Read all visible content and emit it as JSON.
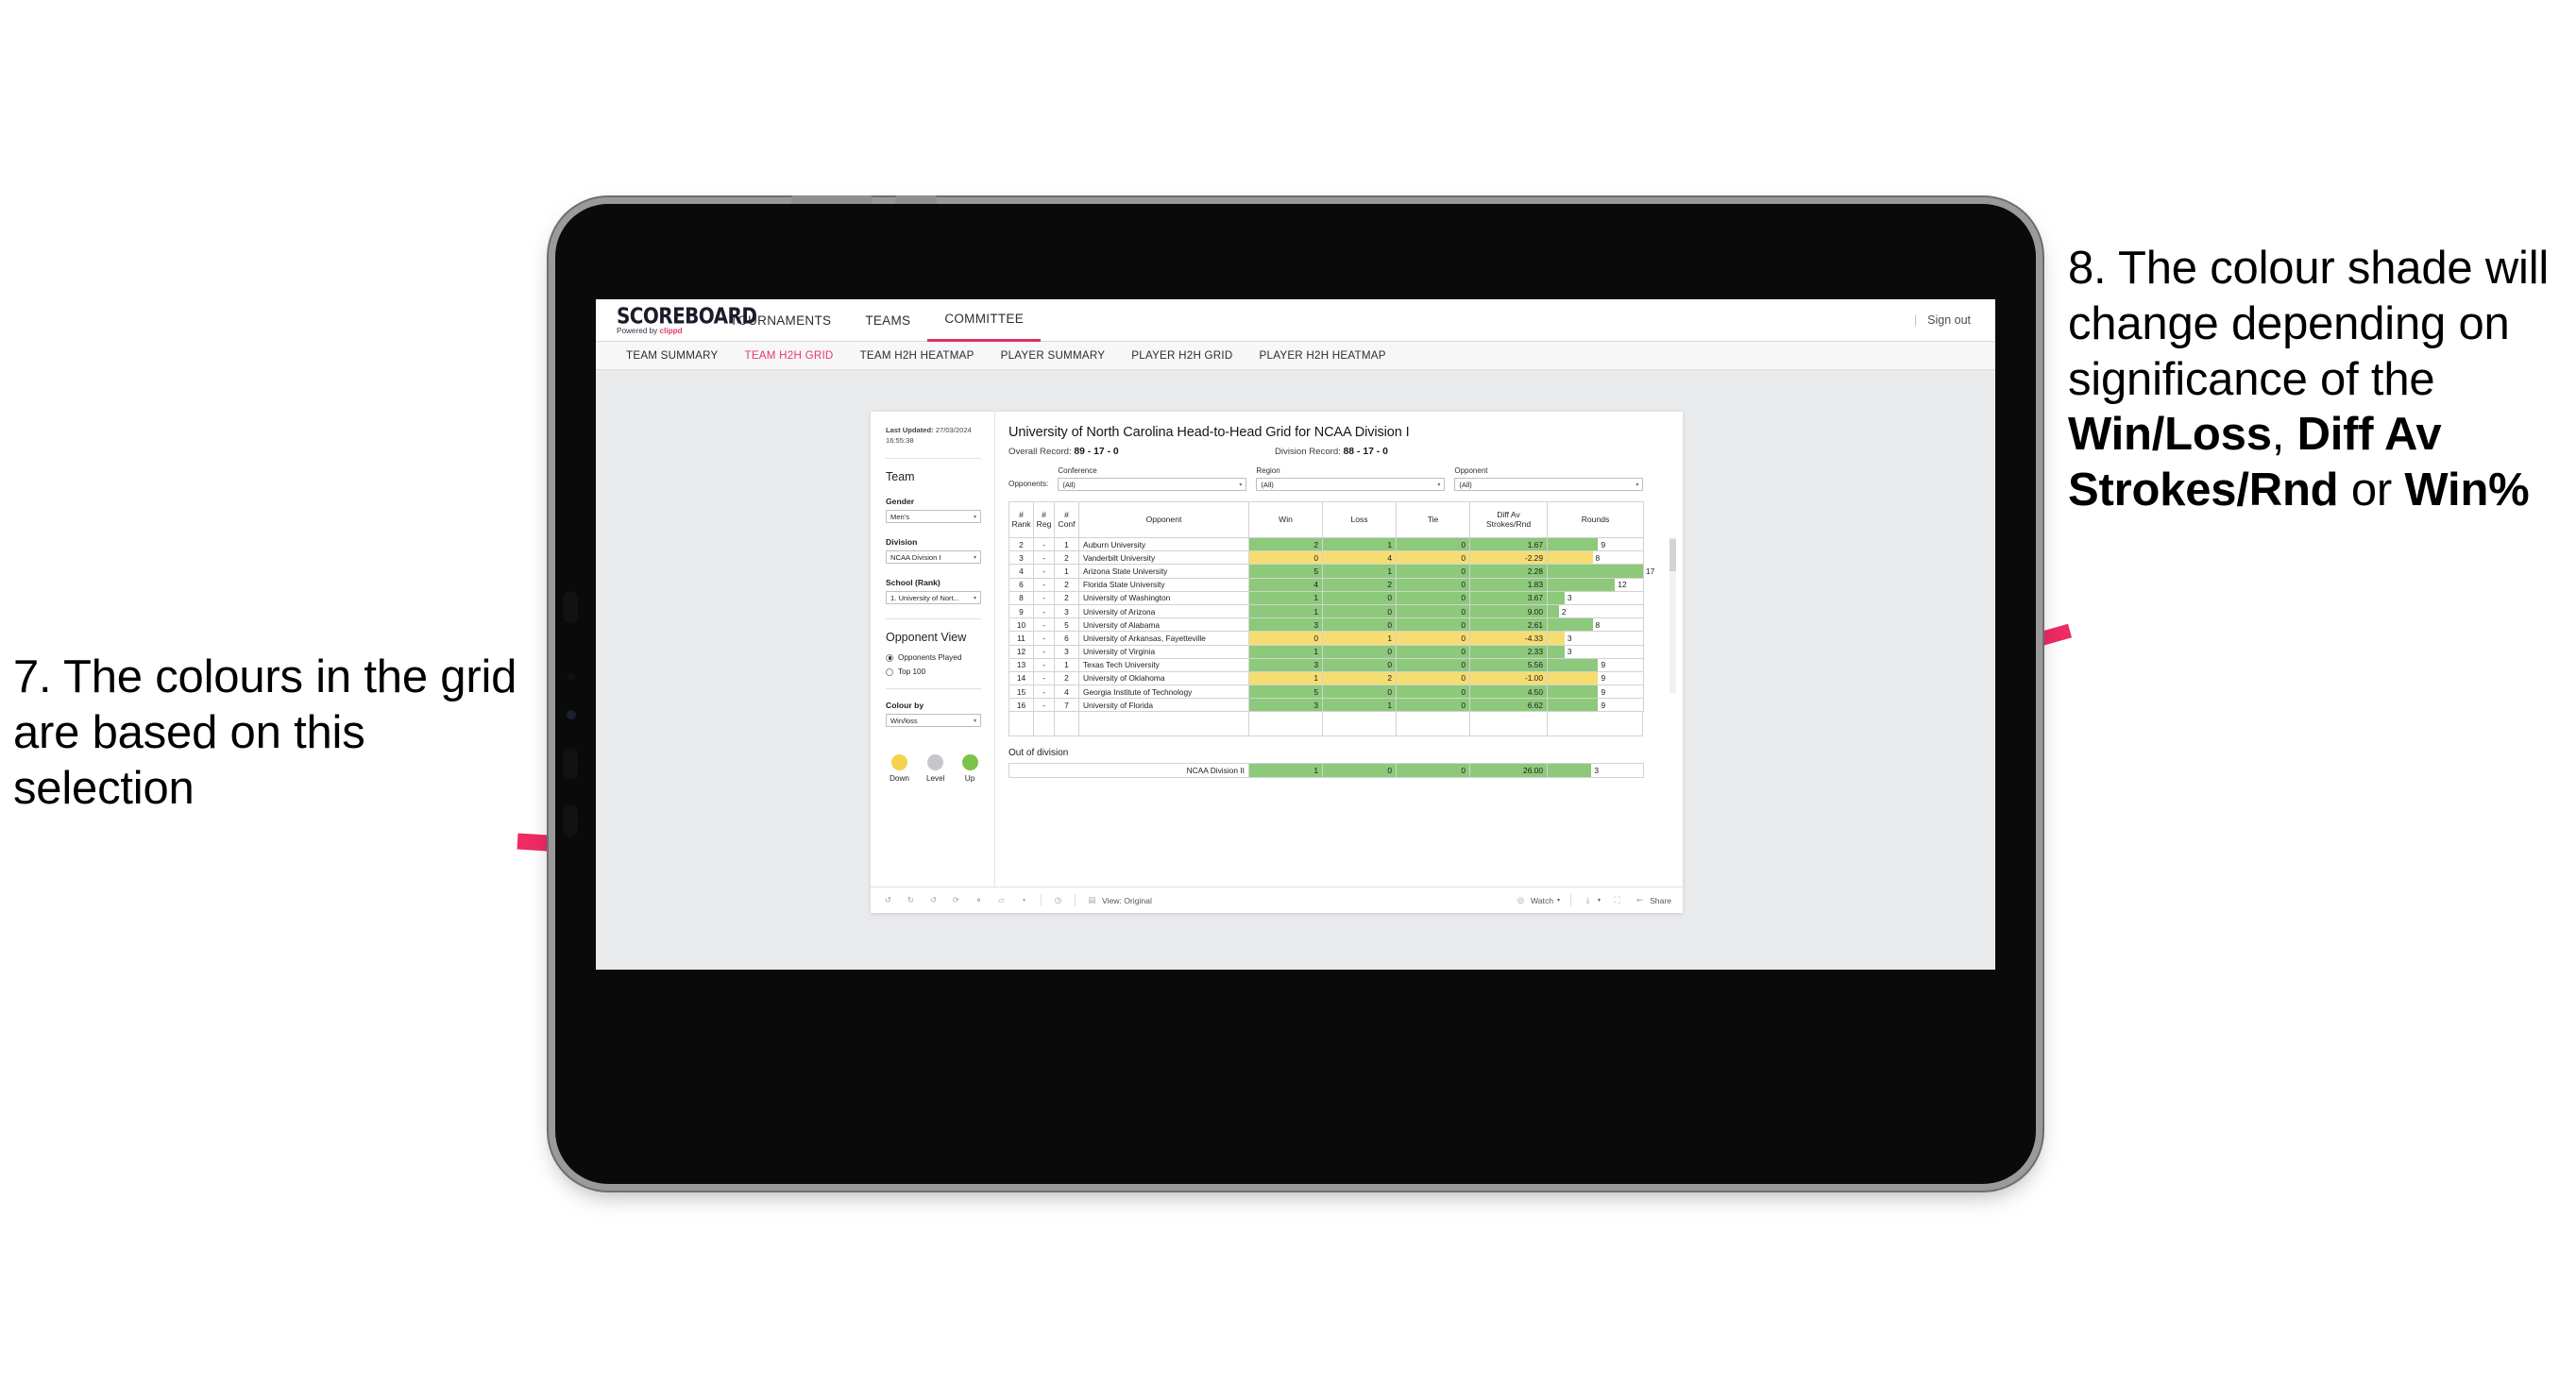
{
  "annotations": {
    "left": "7. The colours in the grid are based on this selection",
    "right_parts": [
      {
        "t": "8. The colour shade will change depending on significance of the ",
        "b": false
      },
      {
        "t": "Win/Loss",
        "b": true
      },
      {
        "t": ", ",
        "b": false
      },
      {
        "t": "Diff Av Strokes/Rnd",
        "b": true
      },
      {
        "t": " or ",
        "b": false
      },
      {
        "t": "Win%",
        "b": true
      }
    ],
    "arrow_color": "#ee2b62"
  },
  "app": {
    "brand_title": "SCOREBOARD",
    "brand_sub_pre": "Powered by ",
    "brand_sub_name": "clippd",
    "brand_accent": "#e8366b",
    "topnav": [
      {
        "label": "TOURNAMENTS",
        "active": false
      },
      {
        "label": "TEAMS",
        "active": false
      },
      {
        "label": "COMMITTEE",
        "active": true
      }
    ],
    "signout": {
      "divider": "|",
      "label": "Sign out"
    },
    "subnav": [
      {
        "label": "TEAM SUMMARY",
        "active": false
      },
      {
        "label": "TEAM H2H GRID",
        "active": true
      },
      {
        "label": "TEAM H2H HEATMAP",
        "active": false
      },
      {
        "label": "PLAYER SUMMARY",
        "active": false
      },
      {
        "label": "PLAYER H2H GRID",
        "active": false
      },
      {
        "label": "PLAYER H2H HEATMAP",
        "active": false
      }
    ]
  },
  "sidebar": {
    "last_updated_label": "Last Updated:",
    "last_updated_value": "27/03/2024 16:55:38",
    "team_heading": "Team",
    "fields": [
      {
        "label": "Gender",
        "value": "Men's"
      },
      {
        "label": "Division",
        "value": "NCAA Division I"
      },
      {
        "label": "School (Rank)",
        "value": "1. University of Nort..."
      }
    ],
    "opponent_view_heading": "Opponent View",
    "opponent_view_options": [
      {
        "label": "Opponents Played",
        "selected": true
      },
      {
        "label": "Top 100",
        "selected": false
      }
    ],
    "colour_by_label": "Colour by",
    "colour_by_value": "Win/loss",
    "legend": [
      {
        "label": "Down",
        "color": "#f4d24e"
      },
      {
        "label": "Level",
        "color": "#c6c6cb"
      },
      {
        "label": "Up",
        "color": "#7dc24b"
      }
    ]
  },
  "viz": {
    "title": "University of North Carolina Head-to-Head Grid for NCAA Division I",
    "overall_record_label": "Overall Record:",
    "overall_record_value": "89 - 17 - 0",
    "division_record_label": "Division Record:",
    "division_record_value": "88 - 17 - 0",
    "opponents_label": "Opponents:",
    "filters": [
      {
        "title": "Conference",
        "value": "(All)"
      },
      {
        "title": "Region",
        "value": "(All)"
      },
      {
        "title": "Opponent",
        "value": "(All)"
      }
    ],
    "out_of_division_label": "Out of division"
  },
  "chart_data": {
    "type": "table",
    "title": "University of North Carolina Head-to-Head Grid for NCAA Division I",
    "columns": [
      "# Rank",
      "# Reg",
      "# Conf",
      "Opponent",
      "Win",
      "Loss",
      "Tie",
      "Diff Av Strokes/Rnd",
      "Rounds"
    ],
    "colour_by": "Win/loss",
    "colours": {
      "up": "#8dc97a",
      "down": "#f5dd72",
      "level": "#c6c6cb",
      "bar": "#8dc97a",
      "bar_down": "#f5dd72"
    },
    "rounds_max": 17,
    "rows": [
      {
        "rank": "2",
        "reg": "-",
        "conf": "1",
        "opponent": "Auburn University",
        "win": "2",
        "loss": "1",
        "tie": "0",
        "diff": "1.67",
        "rounds": "9",
        "state": "up"
      },
      {
        "rank": "3",
        "reg": "-",
        "conf": "2",
        "opponent": "Vanderbilt University",
        "win": "0",
        "loss": "4",
        "tie": "0",
        "diff": "-2.29",
        "rounds": "8",
        "state": "down"
      },
      {
        "rank": "4",
        "reg": "-",
        "conf": "1",
        "opponent": "Arizona State University",
        "win": "5",
        "loss": "1",
        "tie": "0",
        "diff": "2.28",
        "rounds": "17",
        "state": "up"
      },
      {
        "rank": "6",
        "reg": "-",
        "conf": "2",
        "opponent": "Florida State University",
        "win": "4",
        "loss": "2",
        "tie": "0",
        "diff": "1.83",
        "rounds": "12",
        "state": "up"
      },
      {
        "rank": "8",
        "reg": "-",
        "conf": "2",
        "opponent": "University of Washington",
        "win": "1",
        "loss": "0",
        "tie": "0",
        "diff": "3.67",
        "rounds": "3",
        "state": "up"
      },
      {
        "rank": "9",
        "reg": "-",
        "conf": "3",
        "opponent": "University of Arizona",
        "win": "1",
        "loss": "0",
        "tie": "0",
        "diff": "9.00",
        "rounds": "2",
        "state": "up"
      },
      {
        "rank": "10",
        "reg": "-",
        "conf": "5",
        "opponent": "University of Alabama",
        "win": "3",
        "loss": "0",
        "tie": "0",
        "diff": "2.61",
        "rounds": "8",
        "state": "up"
      },
      {
        "rank": "11",
        "reg": "-",
        "conf": "6",
        "opponent": "University of Arkansas, Fayetteville",
        "win": "0",
        "loss": "1",
        "tie": "0",
        "diff": "-4.33",
        "rounds": "3",
        "state": "down"
      },
      {
        "rank": "12",
        "reg": "-",
        "conf": "3",
        "opponent": "University of Virginia",
        "win": "1",
        "loss": "0",
        "tie": "0",
        "diff": "2.33",
        "rounds": "3",
        "state": "up"
      },
      {
        "rank": "13",
        "reg": "-",
        "conf": "1",
        "opponent": "Texas Tech University",
        "win": "3",
        "loss": "0",
        "tie": "0",
        "diff": "5.56",
        "rounds": "9",
        "state": "up"
      },
      {
        "rank": "14",
        "reg": "-",
        "conf": "2",
        "opponent": "University of Oklahoma",
        "win": "1",
        "loss": "2",
        "tie": "0",
        "diff": "-1.00",
        "rounds": "9",
        "state": "down"
      },
      {
        "rank": "15",
        "reg": "-",
        "conf": "4",
        "opponent": "Georgia Institute of Technology",
        "win": "5",
        "loss": "0",
        "tie": "0",
        "diff": "4.50",
        "rounds": "9",
        "state": "up"
      },
      {
        "rank": "16",
        "reg": "-",
        "conf": "7",
        "opponent": "University of Florida",
        "win": "3",
        "loss": "1",
        "tie": "0",
        "diff": "6.62",
        "rounds": "9",
        "state": "up"
      }
    ],
    "out_of_division": [
      {
        "opponent": "NCAA Division II",
        "win": "1",
        "loss": "0",
        "tie": "0",
        "diff": "26.00",
        "rounds": "3",
        "state": "up"
      }
    ]
  },
  "toolbar": {
    "icons": [
      "undo-icon",
      "redo-icon",
      "revert-icon",
      "refresh-icon",
      "pause-icon",
      "rectangle-select-icon"
    ],
    "help_icon": "help-icon",
    "view_icon": "view-icon",
    "view_label": "View: Original",
    "watch_label": "Watch",
    "watch_icon": "watch-icon",
    "download_icon": "download-icon",
    "fullscreen_icon": "fullscreen-icon",
    "share_icon": "share-icon",
    "share_label": "Share",
    "caret": "▾"
  }
}
